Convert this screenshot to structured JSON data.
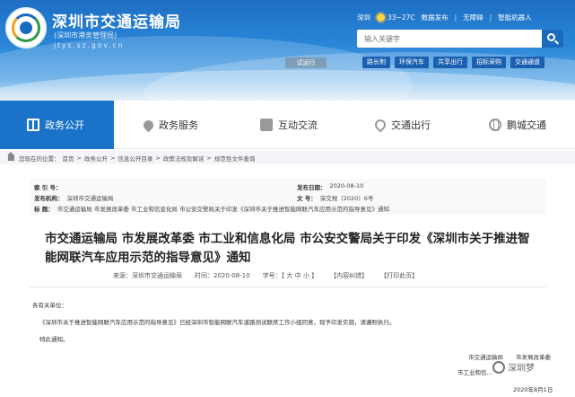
{
  "header": {
    "site_title": "深圳市交通运输局",
    "site_subtitle": "(深圳市港务管理局)",
    "site_url": "jtys.sz.gov.cn",
    "top_links": {
      "city": "深圳",
      "weather_icon": "sun-icon",
      "temperature": "33~27C",
      "data_release": "数据发布",
      "accessibility": "无障碍",
      "robot": "智能机器人"
    },
    "search": {
      "placeholder": "输入关键字"
    },
    "trial_tag": "试运行",
    "quick_links": [
      "路长制",
      "环保汽车",
      "共享出行",
      "招标采购",
      "交通通道"
    ]
  },
  "nav": {
    "items": [
      {
        "label": "政务公开",
        "icon": "book-icon",
        "active": true
      },
      {
        "label": "政务服务",
        "icon": "heart-hand-icon",
        "active": false
      },
      {
        "label": "互动交流",
        "icon": "chat-icon",
        "active": false
      },
      {
        "label": "交通出行",
        "icon": "location-pin-icon",
        "active": false
      },
      {
        "label": "鹏城交通",
        "icon": "globe-icon",
        "active": false
      }
    ]
  },
  "breadcrumb": {
    "prefix": "您现在的位置：",
    "items": [
      "首页",
      "政务公开",
      "信息公开目录",
      "政策法规及解读",
      "规范性文件查询"
    ],
    "separator": ">"
  },
  "meta": {
    "index_key": "索 引 号：",
    "index_val": "",
    "date_key": "发布日期：",
    "date_val": "2020-08-10",
    "org_key": "发布机构：",
    "org_val": "深圳市交通运输局",
    "doc_key": "文 号：",
    "doc_val": "深交规〔2020〕6号",
    "title_key": "标 题：",
    "title_val": "市交通运输局 市发展改革委 市工业和信息化局 市公安交警局关于印发《深圳市关于推进智能网联汽车应用示范的指导意见》通知"
  },
  "article": {
    "title": "市交通运输局 市发展改革委 市工业和信息化局 市公安交警局关于印发《深圳市关于推进智能网联汽车应用示范的指导意见》通知",
    "source": "来源：深圳市交通运输局",
    "time": "时间：2020-08-10",
    "font_size_label": "字号：【 大 中 小 】",
    "correction": "【内容纠错】",
    "print": "【打印此页】",
    "greeting": "各有关单位：",
    "paragraph": "《深圳市关于推进智能网联汽车应用示范的指导意见》已经深圳市智能网联汽车道路测试联席工作小组同意，现予印发实施，请遵照执行。",
    "closing": "特此通知。",
    "signatures": {
      "s1": "市交通运输局",
      "s2": "市发展改革委",
      "s3": "市工业和信...",
      "date": "2020年8月1日"
    }
  },
  "watermark": {
    "text": "深圳梦"
  }
}
